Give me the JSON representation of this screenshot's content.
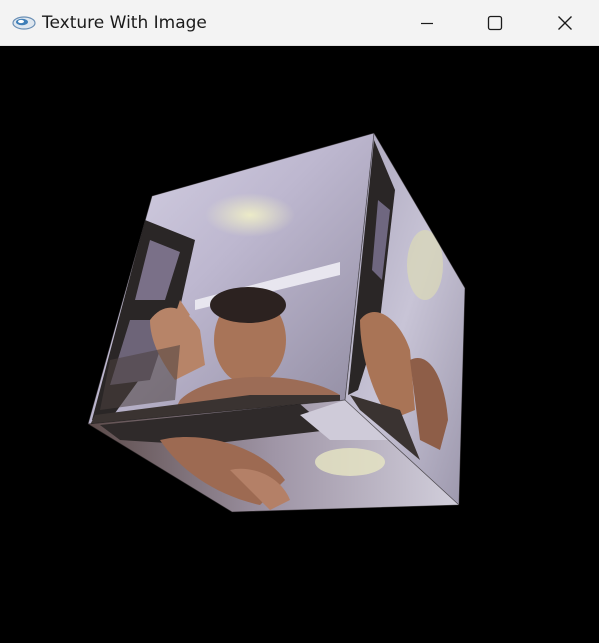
{
  "window": {
    "title": "Texture With Image",
    "app_icon": "opengl-app-icon",
    "controls": {
      "minimize": "minimize-icon",
      "maximize": "maximize-icon",
      "close": "close-icon"
    }
  },
  "scene": {
    "background": "#000000",
    "object": "textured-cube",
    "faces": [
      "cube-face-front",
      "cube-face-right",
      "cube-face-bottom"
    ],
    "colors": {
      "face_light": "#c9c4d8",
      "face_mid": "#8e8aa0",
      "skin": "#b07a60",
      "dark": "#2a2626"
    }
  }
}
